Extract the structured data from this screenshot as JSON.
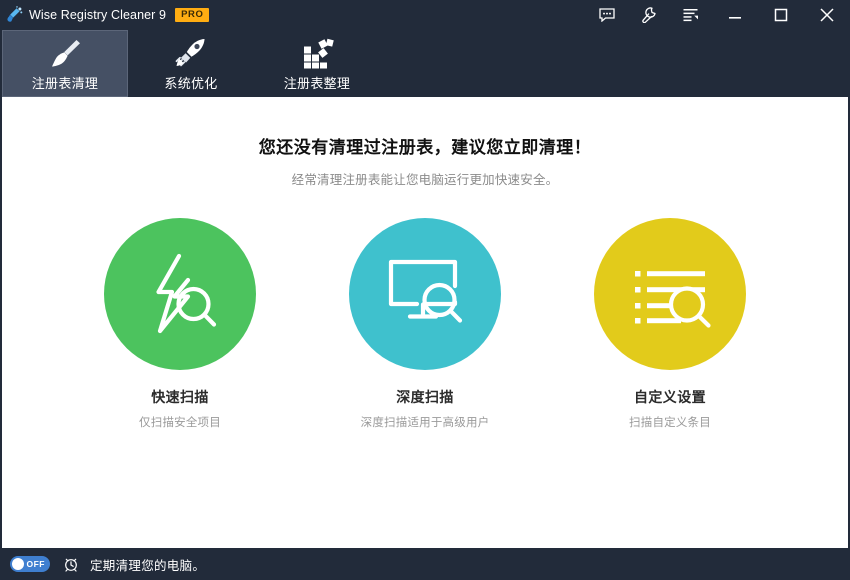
{
  "window": {
    "title": "Wise Registry Cleaner 9",
    "badge": "PRO",
    "app_icon": "broom-sparkle-icon",
    "bg_color": "#222b3a"
  },
  "titlebar": {
    "buttons": [
      {
        "name": "feedback-icon",
        "label": ""
      },
      {
        "name": "tools-wrench-icon",
        "label": ""
      },
      {
        "name": "menu-icon",
        "label": ""
      },
      {
        "name": "minimize-icon",
        "label": ""
      },
      {
        "name": "maximize-icon",
        "label": ""
      },
      {
        "name": "close-icon",
        "label": ""
      }
    ]
  },
  "tabs": [
    {
      "label": "注册表清理",
      "icon": "broom-icon",
      "active": true
    },
    {
      "label": "系统优化",
      "icon": "rocket-icon",
      "active": false
    },
    {
      "label": "注册表整理",
      "icon": "defrag-grid-icon",
      "active": false
    }
  ],
  "main": {
    "headline": "您还没有清理过注册表，建议您立即清理！",
    "subhead": "经常清理注册表能让您电脑运行更加快速安全。",
    "options": [
      {
        "title": "快速扫描",
        "desc": "仅扫描安全项目",
        "color": "#4cc35e",
        "icon": "lightning-search-icon"
      },
      {
        "title": "深度扫描",
        "desc": "深度扫描适用于高级用户",
        "color": "#3fc1cd",
        "icon": "monitor-search-icon"
      },
      {
        "title": "自定义设置",
        "desc": "扫描自定义条目",
        "color": "#e2cb1b",
        "icon": "list-search-icon"
      }
    ]
  },
  "statusbar": {
    "toggle_state": "OFF",
    "toggle_on": false,
    "clock_icon": "alarm-clock-icon",
    "text": "定期清理您的电脑。"
  },
  "colors": {
    "chrome": "#222b3a",
    "tab_active": "#455064",
    "accent_badge": "#ffad12",
    "toggle_track": "#3f7fd0"
  }
}
